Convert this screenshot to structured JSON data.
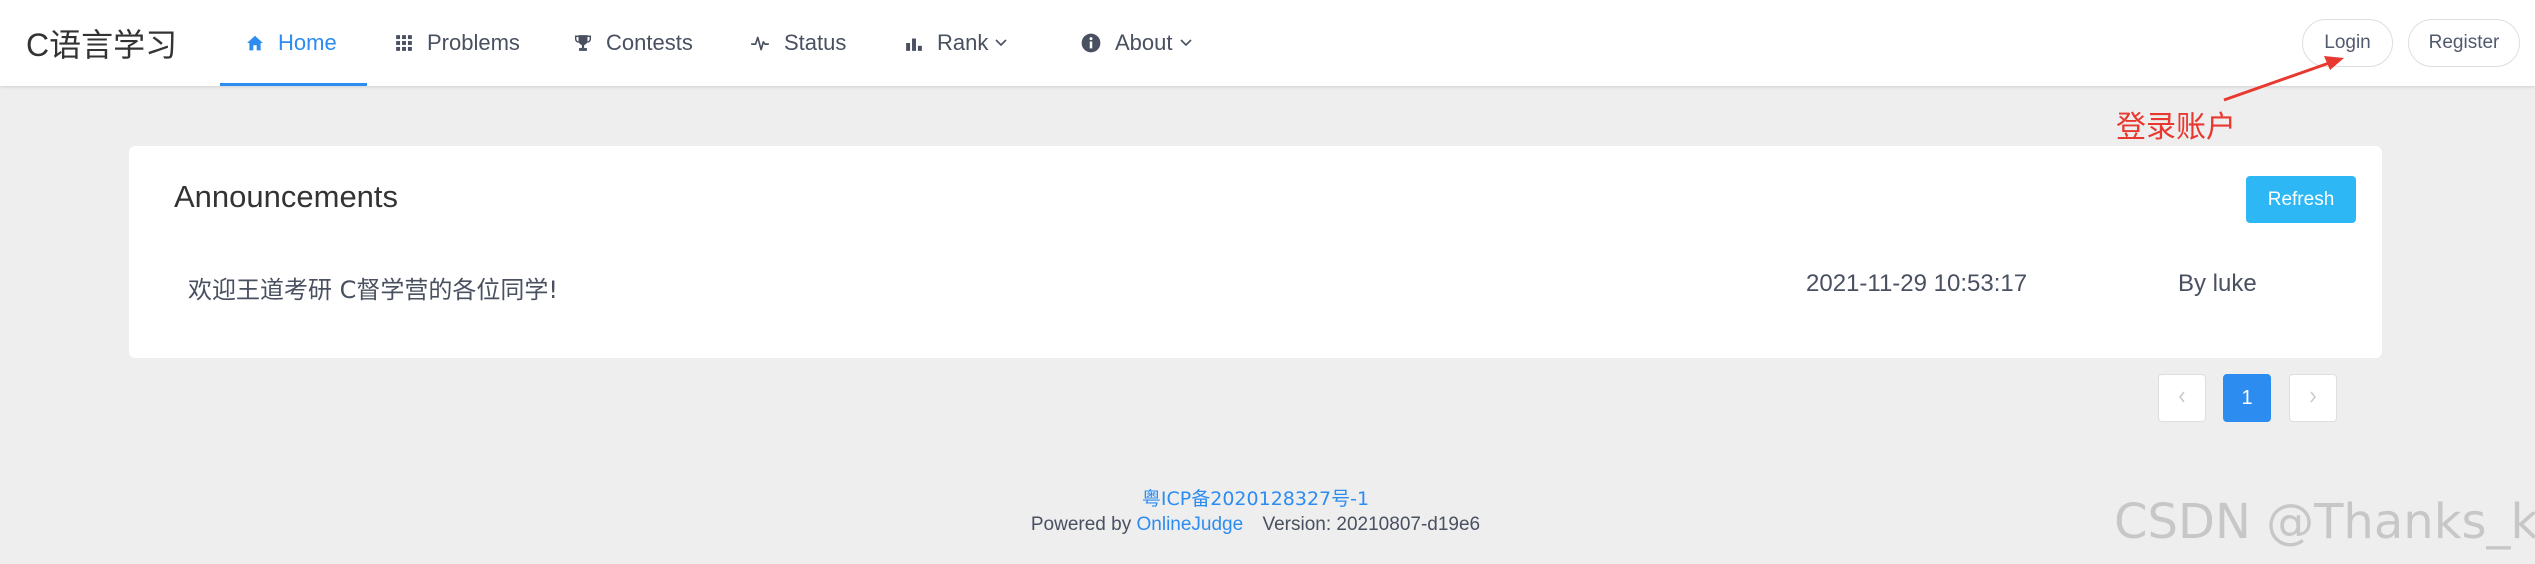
{
  "header": {
    "logo": "C语言学习",
    "nav": [
      {
        "label": "Home",
        "icon": "home-icon",
        "active": true
      },
      {
        "label": "Problems",
        "icon": "grid-icon"
      },
      {
        "label": "Contests",
        "icon": "trophy-icon"
      },
      {
        "label": "Status",
        "icon": "pulse-icon"
      },
      {
        "label": "Rank",
        "icon": "bar-chart-icon",
        "dropdown": true
      },
      {
        "label": "About",
        "icon": "info-icon",
        "dropdown": true
      }
    ],
    "login_label": "Login",
    "register_label": "Register"
  },
  "annotation": {
    "text": "登录账户",
    "color": "#e8382f"
  },
  "announcements": {
    "title": "Announcements",
    "refresh_label": "Refresh",
    "items": [
      {
        "title": "欢迎王道考研 C督学营的各位同学!",
        "date": "2021-11-29 10:53:17",
        "author": "By luke"
      }
    ]
  },
  "pagination": {
    "current_page": "1"
  },
  "footer": {
    "icp": "粤ICP备2020128327号-1",
    "powered_prefix": "Powered by",
    "powered_link": "OnlineJudge",
    "version": "Version: 20210807-d19e6"
  },
  "watermark": "CSDN @Thanks_ks",
  "colors": {
    "accent": "#2d8cf0",
    "refresh": "#2db7f5",
    "background": "#eeeeee"
  }
}
